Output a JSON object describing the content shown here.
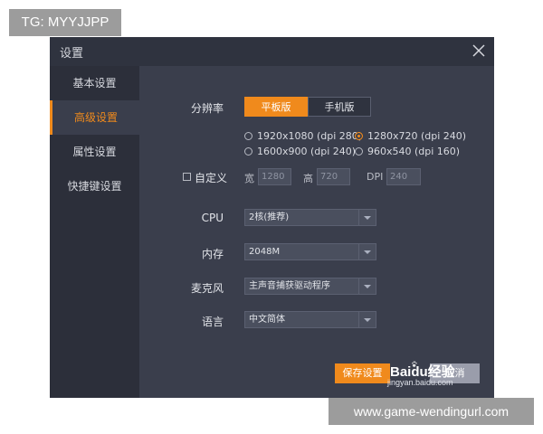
{
  "overlay": {
    "tg_label": "TG: MYYJJPP",
    "url_label": "www.game-wendingurl.com"
  },
  "dialog": {
    "title": "设置",
    "close_icon": "close-icon"
  },
  "sidebar": {
    "items": [
      {
        "label": "基本设置"
      },
      {
        "label": "高级设置"
      },
      {
        "label": "属性设置"
      },
      {
        "label": "快捷键设置"
      }
    ]
  },
  "settings": {
    "resolution_label": "分辨率",
    "mode_tabs": [
      {
        "label": "平板版",
        "selected": true
      },
      {
        "label": "手机版",
        "selected": false
      }
    ],
    "resolution_options": [
      {
        "label": "1920x1080 (dpi 280)",
        "selected": false
      },
      {
        "label": "1280x720 (dpi 240)",
        "selected": true
      },
      {
        "label": "1600x900 (dpi 240)",
        "selected": false
      },
      {
        "label": "960x540 (dpi 160)",
        "selected": false
      }
    ],
    "custom": {
      "label": "自定义",
      "width_label": "宽",
      "width_value": "1280",
      "height_label": "高",
      "height_value": "720",
      "dpi_label": "DPI",
      "dpi_value": "240"
    },
    "cpu": {
      "label": "CPU",
      "value": "2核(推荐)"
    },
    "memory": {
      "label": "内存",
      "value": "2048M"
    },
    "microphone": {
      "label": "麦克风",
      "value": "主声音捕获驱动程序"
    },
    "language": {
      "label": "语言",
      "value": "中文简体"
    }
  },
  "actions": {
    "save_label": "保存设置",
    "cancel_label": "取消"
  },
  "watermark": {
    "text": "Baidu经验",
    "sub": "jingyan.baidu.com"
  },
  "colors": {
    "accent": "#f08a1c",
    "dialog_bg": "#3a3e4c",
    "sidebar_bg": "#2c2f3a"
  }
}
